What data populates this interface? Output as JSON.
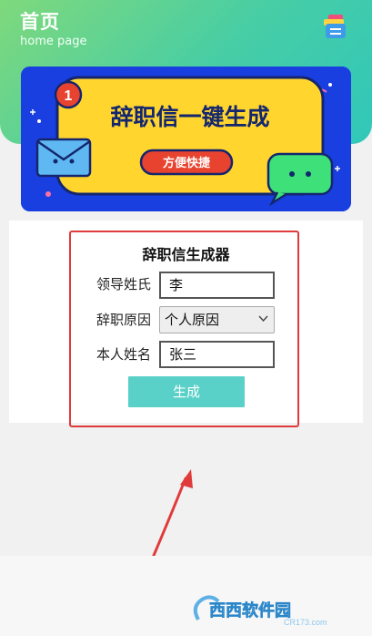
{
  "header": {
    "title": "首页",
    "subtitle": "home page",
    "menu_icon": "stacked-cards-icon"
  },
  "banner": {
    "badge": "1",
    "headline": "辞职信一键生成",
    "tagline": "方便快捷",
    "icons": [
      "envelope-icon",
      "chat-bubble-icon"
    ],
    "colors": {
      "background": "#1a3fe0",
      "panel": "#ffd52e",
      "pill": "#e8432f"
    }
  },
  "form": {
    "title": "辞职信生成器",
    "fields": [
      {
        "label": "领导姓氏",
        "value": "李"
      },
      {
        "label": "辞职原因",
        "value": "个人原因"
      },
      {
        "label": "本人姓名",
        "value": "张三"
      }
    ],
    "submit_label": "生成"
  },
  "watermark": {
    "brand": "西西软件园",
    "domain": "CR173.com"
  },
  "colors": {
    "header_gradient_start": "#7fd97c",
    "header_gradient_end": "#31c7ba",
    "button": "#5ad1c8",
    "annotation": "#e03b3b"
  }
}
